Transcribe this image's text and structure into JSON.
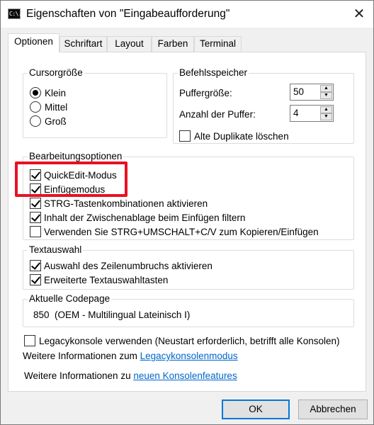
{
  "window": {
    "title": "Eigenschaften von \"Eingabeaufforderung\"",
    "icon_text": "C:\\."
  },
  "tabs": [
    {
      "label": "Optionen",
      "active": true
    },
    {
      "label": "Schriftart",
      "active": false
    },
    {
      "label": "Layout",
      "active": false
    },
    {
      "label": "Farben",
      "active": false
    },
    {
      "label": "Terminal",
      "active": false
    }
  ],
  "cursor_size": {
    "label": "Cursorgröße",
    "options": [
      {
        "label": "Klein",
        "selected": true
      },
      {
        "label": "Mittel",
        "selected": false
      },
      {
        "label": "Groß",
        "selected": false
      }
    ]
  },
  "command_history": {
    "label": "Befehlsspeicher",
    "buffer_size_label": "Puffergröße:",
    "buffer_size_value": "50",
    "buffer_count_label": "Anzahl der Puffer:",
    "buffer_count_value": "4",
    "discard_duplicates_label": "Alte Duplikate löschen",
    "discard_duplicates_checked": false
  },
  "edit_options": {
    "label": "Bearbeitungsoptionen",
    "items": [
      {
        "label": "QuickEdit-Modus",
        "checked": true
      },
      {
        "label": "Einfügemodus",
        "checked": true
      },
      {
        "label": "STRG-Tastenkombinationen aktivieren",
        "checked": true
      },
      {
        "label": "Inhalt der Zwischenablage beim Einfügen filtern",
        "checked": true
      },
      {
        "label": "Verwenden Sie STRG+UMSCHALT+C/V zum Kopieren/Einfügen",
        "checked": false
      }
    ]
  },
  "text_selection": {
    "label": "Textauswahl",
    "items": [
      {
        "label": "Auswahl des Zeilenumbruchs aktivieren",
        "checked": true
      },
      {
        "label": "Erweiterte Textauswahltasten",
        "checked": true
      }
    ]
  },
  "codepage": {
    "label": "Aktuelle Codepage",
    "value": "850  (OEM - Multilingual Lateinisch I)"
  },
  "legacy": {
    "label": "Legacykonsole verwenden (Neustart erforderlich, betrifft alle Konsolen)",
    "checked": false,
    "info_prefix": "Weitere Informationen zum ",
    "info_link": "Legacykonsolenmodus"
  },
  "features": {
    "info_prefix": "Weitere Informationen zu ",
    "info_link": "neuen Konsolenfeatures"
  },
  "buttons": {
    "ok": "OK",
    "cancel": "Abbrechen"
  },
  "colors": {
    "highlight": "#e81123",
    "link": "#0066cc",
    "default_button_border": "#0078d7"
  }
}
